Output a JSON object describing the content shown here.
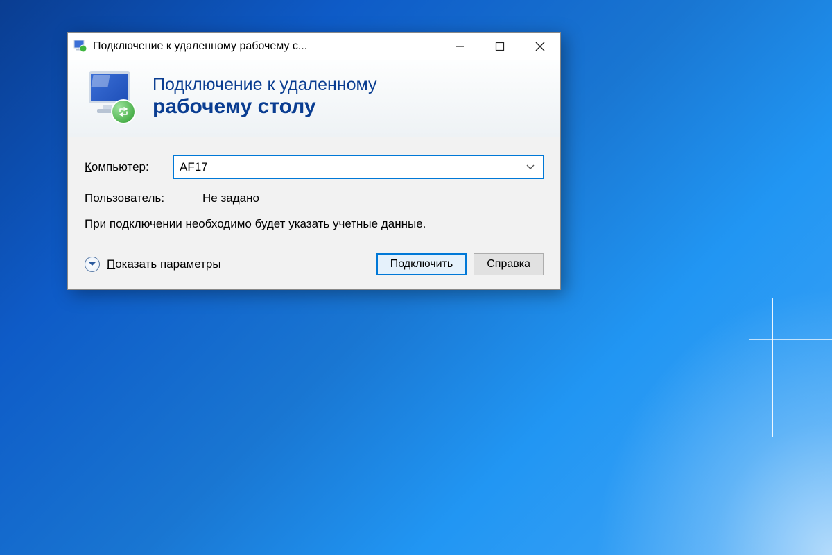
{
  "window": {
    "title": "Подключение к удаленному рабочему с..."
  },
  "header": {
    "line1": "Подключение к удаленному",
    "line2": "рабочему столу"
  },
  "form": {
    "computer_label": "Компьютер:",
    "computer_value": "AF17",
    "user_label": "Пользователь:",
    "user_value": "Не задано",
    "info_text": "При подключении необходимо будет указать учетные данные."
  },
  "footer": {
    "show_options": "Показать параметры",
    "connect": "Подключить",
    "help": "Справка"
  }
}
